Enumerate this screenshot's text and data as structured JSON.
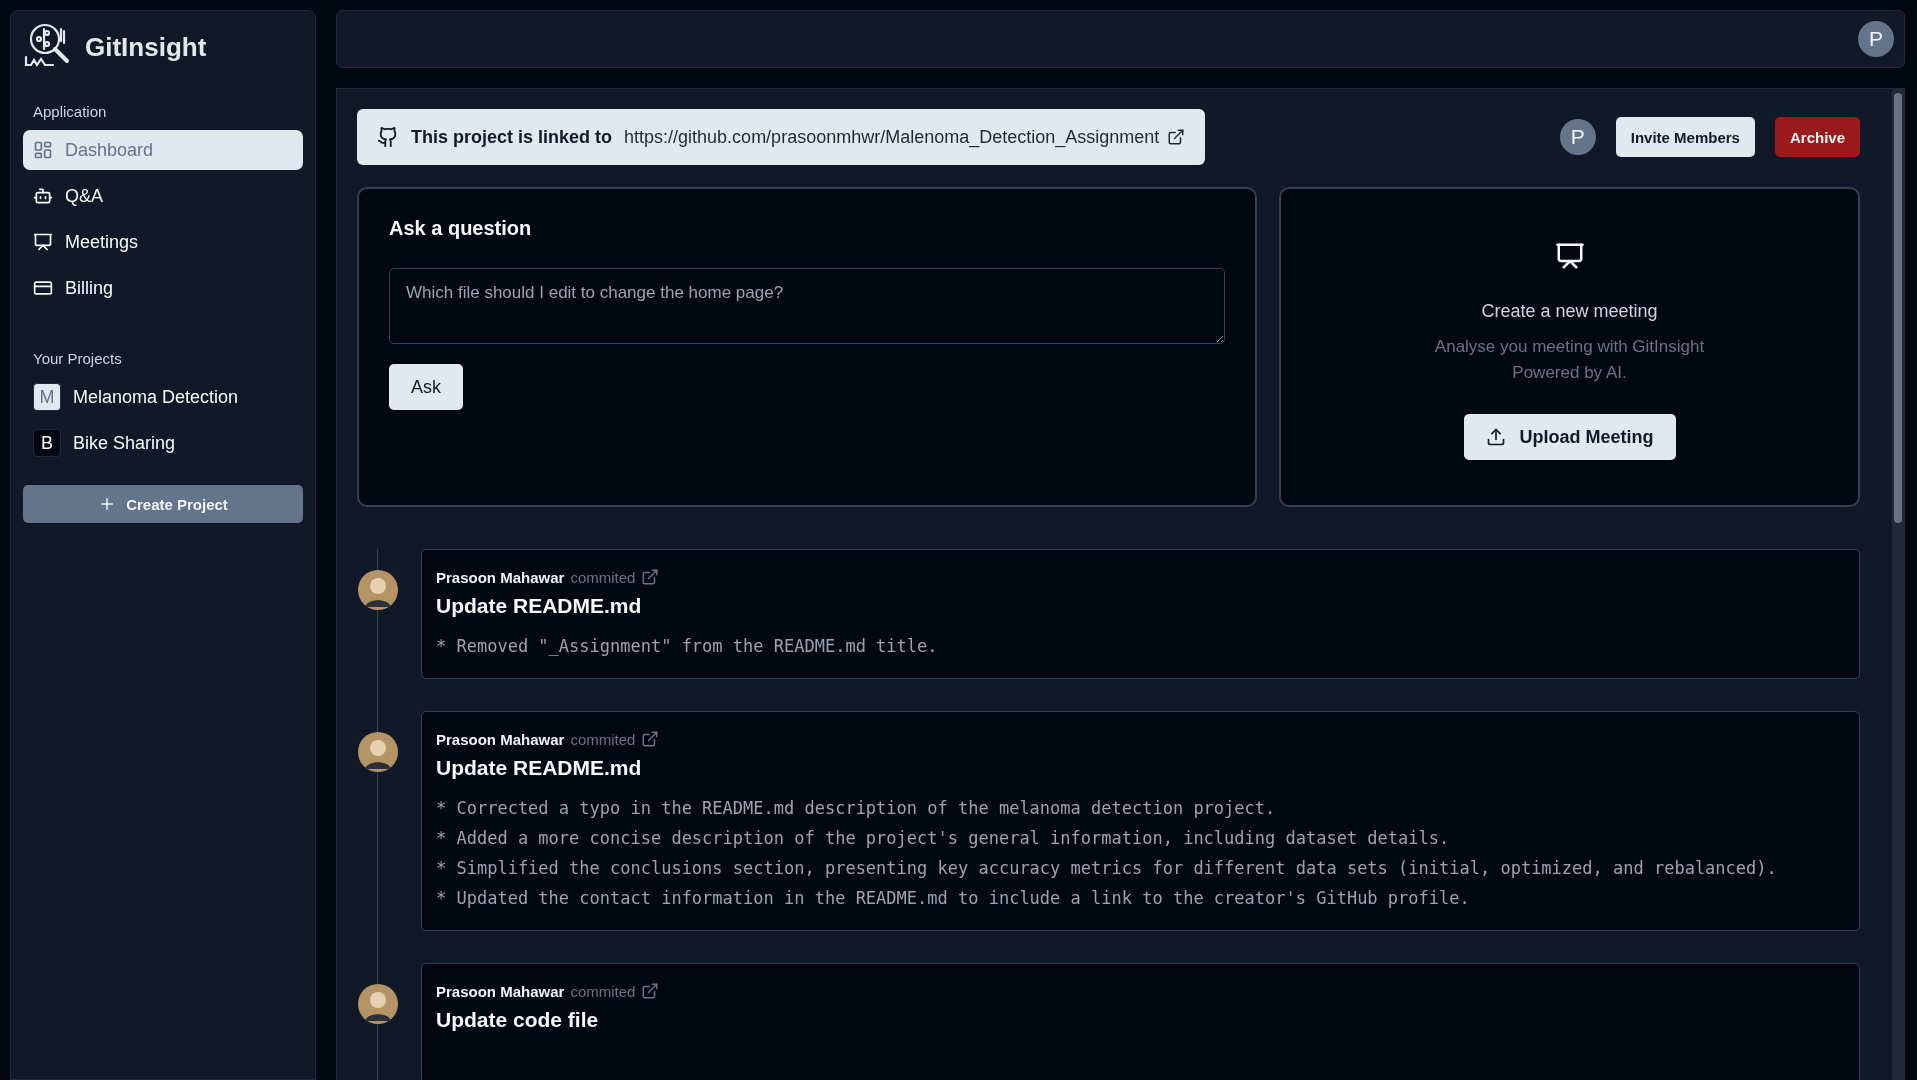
{
  "sidebar": {
    "brand": "GitInsight",
    "application": {
      "title": "Application",
      "items": [
        {
          "label": "Dashboard",
          "kind": "dashboard",
          "selected": true
        },
        {
          "label": "Q&A",
          "kind": "bot",
          "selected": false
        },
        {
          "label": "Meetings",
          "kind": "presentation",
          "selected": false
        },
        {
          "label": "Billing",
          "kind": "card",
          "selected": false
        }
      ]
    },
    "projects": {
      "title": "Your Projects",
      "items": [
        {
          "initial": "M",
          "name": "Melanoma Detection",
          "selected": true
        },
        {
          "initial": "B",
          "name": "Bike Sharing",
          "selected": false
        }
      ]
    },
    "create_button": "Create Project"
  },
  "topbar": {
    "user_initial": "P"
  },
  "banner": {
    "prefix": "This project is linked to",
    "url": "https://github.com/prasoonmhwr/Malenoma_Detection_Assignment"
  },
  "team": {
    "member_initial": "P",
    "invite_button": "Invite Members",
    "archive_button": "Archive"
  },
  "ask": {
    "title": "Ask a question",
    "placeholder": "Which file should I edit to change the home page?",
    "button": "Ask"
  },
  "meeting": {
    "title": "Create a new meeting",
    "description_line_1": "Analyse you meeting with GitInsight",
    "description_line_2": "Powered by AI.",
    "button": "Upload Meeting"
  },
  "commits": [
    {
      "author": "Prasoon Mahawar",
      "action": "commited",
      "title": "Update README.md",
      "lines": [
        "* Removed \"_Assignment\" from the README.md title."
      ]
    },
    {
      "author": "Prasoon Mahawar",
      "action": "commited",
      "title": "Update README.md",
      "lines": [
        "* Corrected a typo in the README.md description of the melanoma detection project.",
        "* Added a more concise description of the project's general information, including dataset details.",
        "* Simplified the conclusions section, presenting key accuracy metrics for different data sets (initial, optimized, and rebalanced).",
        "* Updated the contact information in the README.md to include a link to the creator's GitHub profile."
      ]
    },
    {
      "author": "Prasoon Mahawar",
      "action": "commited",
      "title": "Update code file"
    }
  ]
}
